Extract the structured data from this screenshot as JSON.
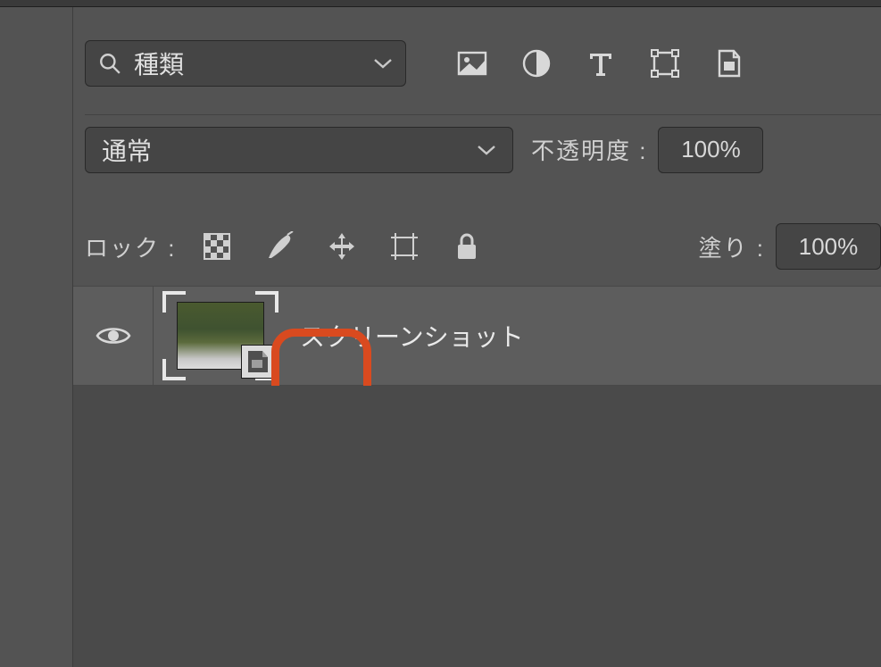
{
  "filter": {
    "label": "種類",
    "icons": [
      "image-filter-icon",
      "adjustment-filter-icon",
      "type-filter-icon",
      "shape-filter-icon",
      "smartobject-filter-icon"
    ]
  },
  "blend": {
    "mode": "通常",
    "opacity_label": "不透明度 :",
    "opacity_value": "100%"
  },
  "lock": {
    "label": "ロック :",
    "fill_label": "塗り :",
    "fill_value": "100%"
  },
  "layers": [
    {
      "name": "スクリーンショット",
      "visible": true,
      "smart_object": true
    }
  ],
  "annotations": {
    "highlight_smart_object_badge": true
  },
  "colors": {
    "panel_bg": "#535353",
    "control_bg": "#454545",
    "layer_bg": "#5d5d5d",
    "highlight": "#d94a1f"
  }
}
